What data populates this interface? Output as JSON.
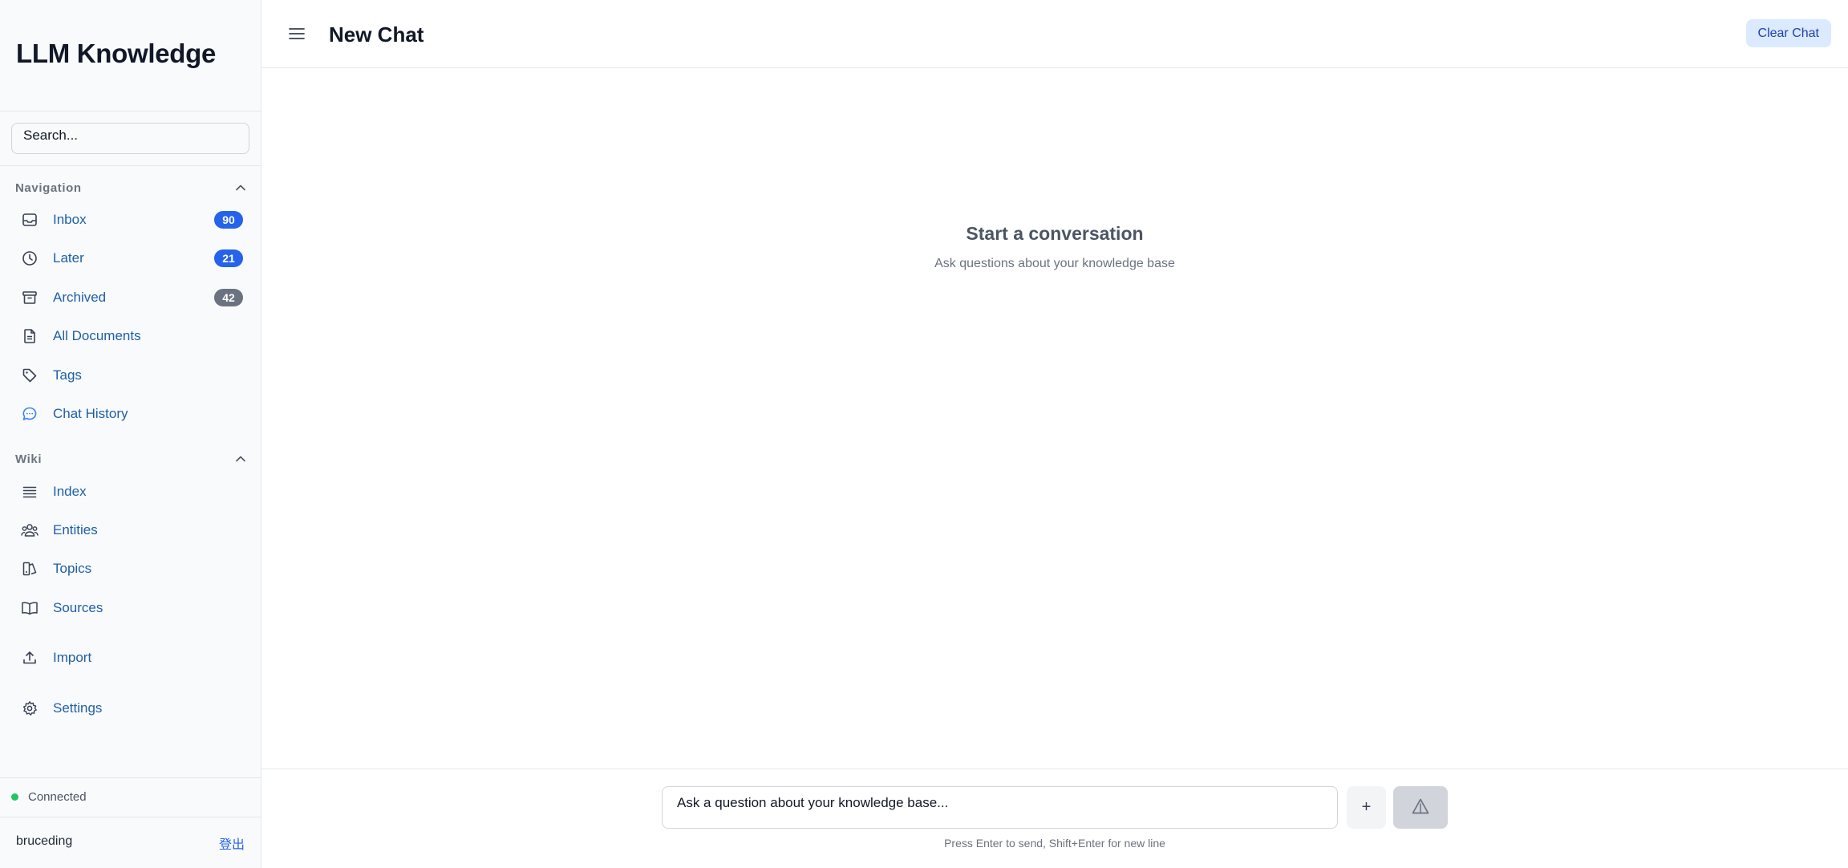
{
  "sidebar": {
    "brand": "LLM Knowledge",
    "search_placeholder": "Search...",
    "navigation": {
      "title": "Navigation",
      "items": [
        {
          "label": "Inbox",
          "badge": "90",
          "icon": "inbox-icon"
        },
        {
          "label": "Later",
          "badge": "21",
          "icon": "clock-icon"
        },
        {
          "label": "Archived",
          "badge": "42",
          "icon": "archive-icon"
        },
        {
          "label": "All Documents",
          "icon": "document-icon"
        },
        {
          "label": "Tags",
          "icon": "tag-icon"
        },
        {
          "label": "Chat History",
          "icon": "chat-icon"
        }
      ]
    },
    "wiki": {
      "title": "Wiki",
      "items": [
        {
          "label": "Index",
          "icon": "list-icon"
        },
        {
          "label": "Entities",
          "icon": "users-icon"
        },
        {
          "label": "Topics",
          "icon": "topics-icon"
        },
        {
          "label": "Sources",
          "icon": "book-icon"
        }
      ]
    },
    "import_label": "Import",
    "settings_label": "Settings",
    "status": "Connected",
    "username": "bruceding",
    "logout": "登出"
  },
  "header": {
    "title": "New Chat",
    "clear_label": "Clear Chat"
  },
  "empty_state": {
    "title": "Start a conversation",
    "subtitle": "Ask questions about your knowledge base"
  },
  "composer": {
    "placeholder": "Ask a question about your knowledge base...",
    "plus_label": "+",
    "hint": "Press Enter to send, Shift+Enter for new line"
  },
  "colors": {
    "accent": "#2563eb",
    "link": "#1f5fa6",
    "badge_gray": "#6b7280",
    "status_green": "#22c55e"
  }
}
